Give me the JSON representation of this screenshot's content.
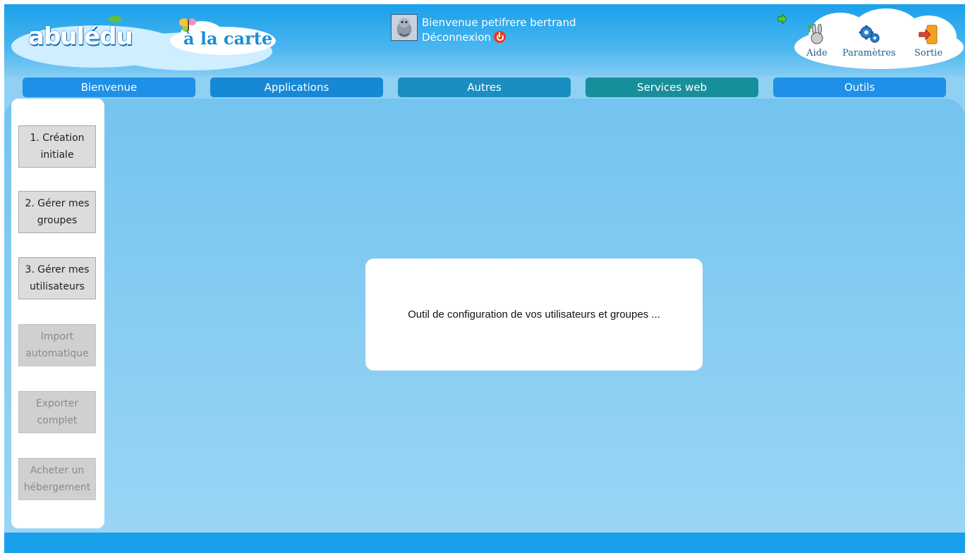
{
  "header": {
    "logo": {
      "brand": "abulédu",
      "product": "à la carte"
    },
    "user": {
      "welcome": "Bienvenue petifrere bertrand",
      "logout_label": "Déconnexion"
    },
    "tools": [
      {
        "label": "Aide",
        "icon": "help-rabbit-icon"
      },
      {
        "label": "Paramètres",
        "icon": "gears-icon"
      },
      {
        "label": "Sortie",
        "icon": "exit-door-icon"
      }
    ]
  },
  "nav": {
    "tabs": [
      {
        "label": "Bienvenue",
        "color": "#1e90e8"
      },
      {
        "label": "Applications",
        "color": "#1788d6"
      },
      {
        "label": "Autres",
        "color": "#1a8ec0"
      },
      {
        "label": "Services web",
        "color": "#178f9a"
      },
      {
        "label": "Outils",
        "color": "#1e90e8"
      }
    ]
  },
  "sidebar": {
    "items": [
      {
        "line1": "1. Création",
        "line2": "initiale",
        "enabled": true
      },
      {
        "line1": "2. Gérer mes",
        "line2": "groupes",
        "enabled": true
      },
      {
        "line1": "3. Gérer mes",
        "line2": "utilisateurs",
        "enabled": true
      },
      {
        "line1": "Import",
        "line2": "automatique",
        "enabled": false
      },
      {
        "line1": "Exporter",
        "line2": "complet",
        "enabled": false
      },
      {
        "line1": "Acheter un",
        "line2": "hébergement",
        "enabled": false
      }
    ]
  },
  "main": {
    "message": "Outil de configuration de vos utilisateurs et groupes ..."
  },
  "colors": {
    "header_blue": "#1aa0ea",
    "content_blue": "#8fd0f3",
    "footer_blue": "#1aa0ea"
  }
}
